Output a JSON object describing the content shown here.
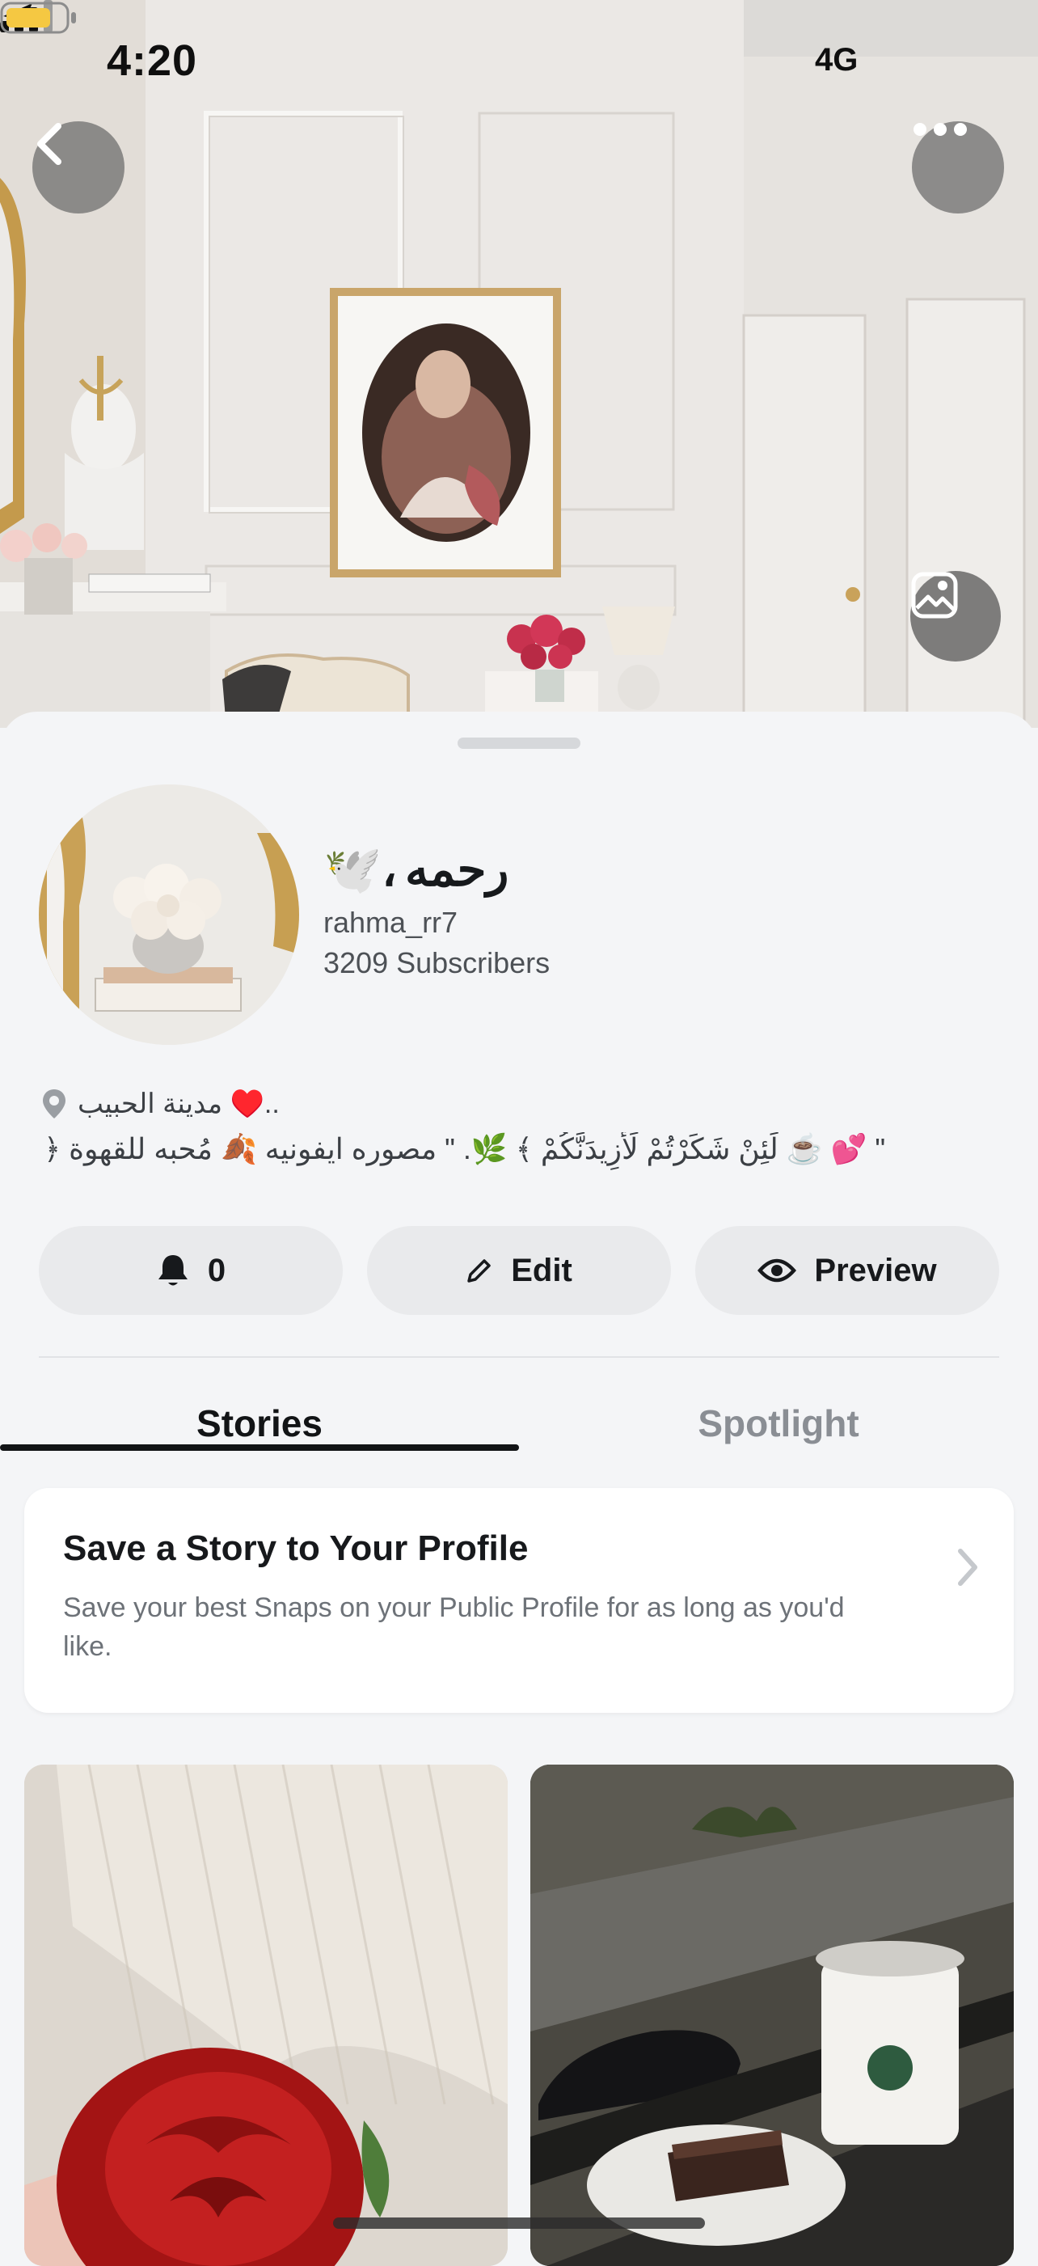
{
  "status_bar": {
    "time": "4:20",
    "network": "4G"
  },
  "profile": {
    "display_name": "رحمه",
    "display_suffix": "🕊️،",
    "username": "rahma_rr7",
    "subscribers": "3209 Subscribers",
    "location": "مدينة الحبيب ♥️..",
    "bio": "﴿ لَئِنْ شَكَرْتُمْ لَأَزِيدَنَّكُمْ ﴾ 🌿. \" مصوره ايفونيه 🍂 مُحبه للقهوة ☕️ 💕 \""
  },
  "actions": {
    "notifications_count": "0",
    "edit_label": "Edit",
    "preview_label": "Preview"
  },
  "tabs": [
    {
      "label": "Stories",
      "active": true
    },
    {
      "label": "Spotlight",
      "active": false
    }
  ],
  "save_card": {
    "title": "Save a Story to Your Profile",
    "text": "Save your best Snaps on your Public Profile for as long as you'd like."
  },
  "icons": {
    "back": "chevron-left-icon",
    "more": "ellipsis-icon",
    "background": "image-edit-icon",
    "bell": "bell-icon",
    "pencil": "pencil-icon",
    "eye": "eye-icon",
    "pin": "map-pin-icon"
  },
  "colors": {
    "accent": "#121416",
    "battery": "#f5c842",
    "sheet": "#f4f5f7"
  }
}
